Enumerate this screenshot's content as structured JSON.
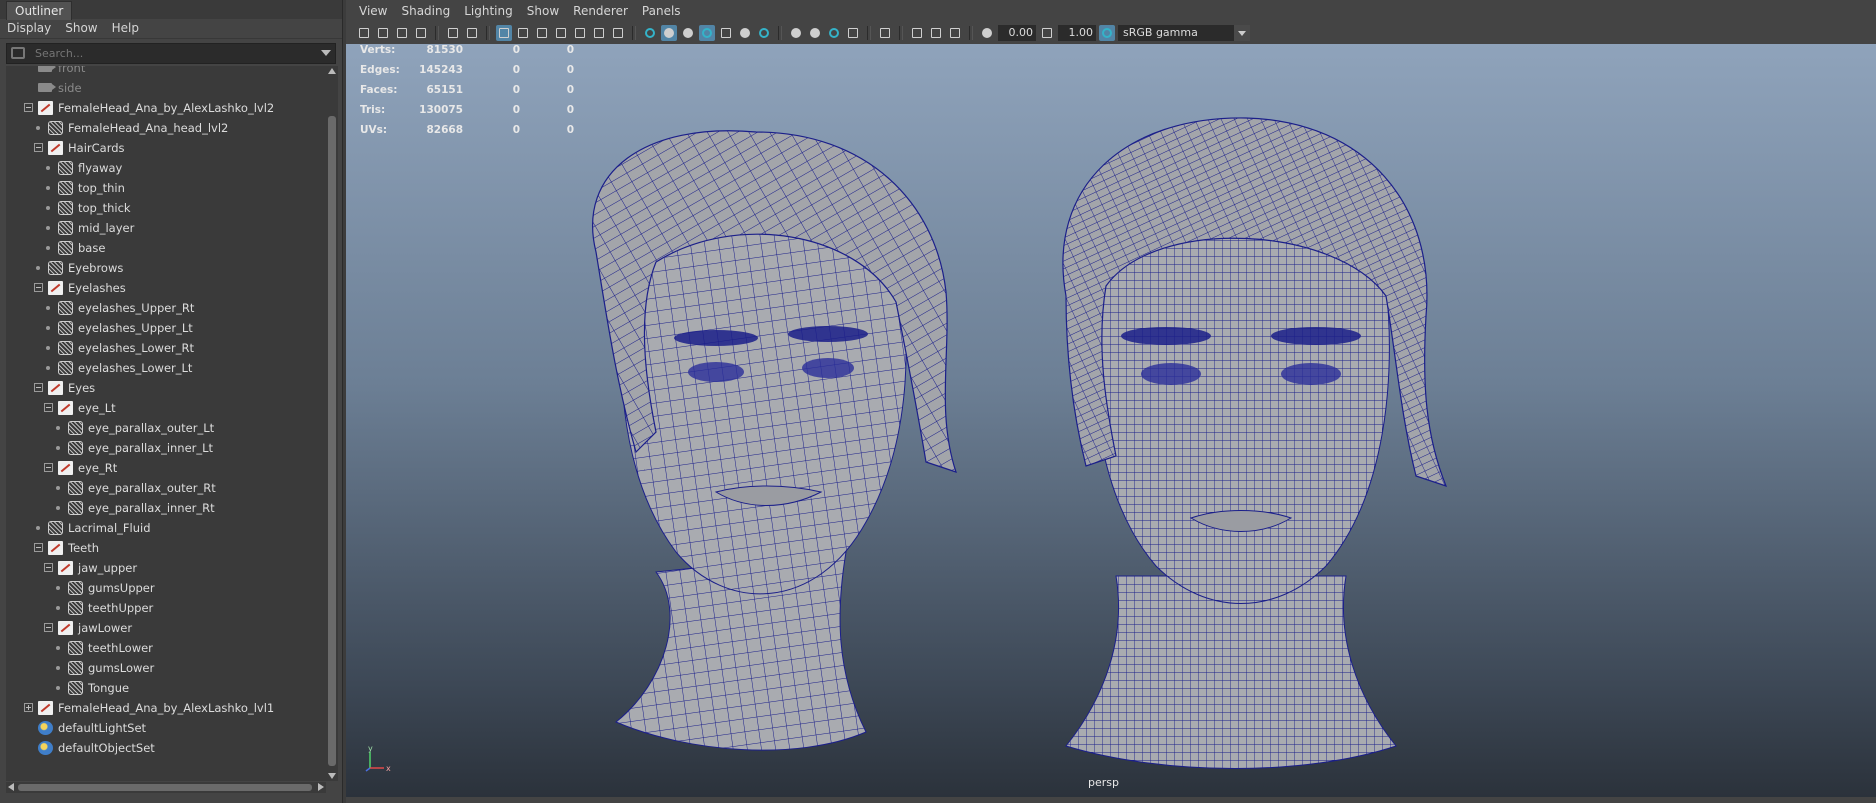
{
  "outliner": {
    "tab_label": "Outliner",
    "menu": [
      "Display",
      "Show",
      "Help"
    ],
    "search_placeholder": "Search...",
    "items": [
      {
        "label": "front",
        "depth": 0,
        "kind": "camera",
        "dim": true,
        "expander": "none"
      },
      {
        "label": "side",
        "depth": 0,
        "kind": "camera",
        "dim": true,
        "expander": "none"
      },
      {
        "label": "FemaleHead_Ana_by_AlexLashko_lvl2",
        "depth": 0,
        "kind": "group",
        "expander": "minus"
      },
      {
        "label": "FemaleHead_Ana_head_lvl2",
        "depth": 1,
        "kind": "mesh",
        "expander": "none"
      },
      {
        "label": "HairCards",
        "depth": 1,
        "kind": "group",
        "expander": "minus"
      },
      {
        "label": "flyaway",
        "depth": 2,
        "kind": "mesh",
        "expander": "none"
      },
      {
        "label": "top_thin",
        "depth": 2,
        "kind": "mesh",
        "expander": "none"
      },
      {
        "label": "top_thick",
        "depth": 2,
        "kind": "mesh",
        "expander": "none"
      },
      {
        "label": "mid_layer",
        "depth": 2,
        "kind": "mesh",
        "expander": "none"
      },
      {
        "label": "base",
        "depth": 2,
        "kind": "mesh",
        "expander": "none"
      },
      {
        "label": "Eyebrows",
        "depth": 1,
        "kind": "mesh",
        "expander": "none"
      },
      {
        "label": "Eyelashes",
        "depth": 1,
        "kind": "group",
        "expander": "minus"
      },
      {
        "label": "eyelashes_Upper_Rt",
        "depth": 2,
        "kind": "mesh",
        "expander": "none"
      },
      {
        "label": "eyelashes_Upper_Lt",
        "depth": 2,
        "kind": "mesh",
        "expander": "none"
      },
      {
        "label": "eyelashes_Lower_Rt",
        "depth": 2,
        "kind": "mesh",
        "expander": "none"
      },
      {
        "label": "eyelashes_Lower_Lt",
        "depth": 2,
        "kind": "mesh",
        "expander": "none"
      },
      {
        "label": "Eyes",
        "depth": 1,
        "kind": "group",
        "expander": "minus"
      },
      {
        "label": "eye_Lt",
        "depth": 2,
        "kind": "group",
        "expander": "minus"
      },
      {
        "label": "eye_parallax_outer_Lt",
        "depth": 3,
        "kind": "mesh",
        "expander": "none"
      },
      {
        "label": "eye_parallax_inner_Lt",
        "depth": 3,
        "kind": "mesh",
        "expander": "none"
      },
      {
        "label": "eye_Rt",
        "depth": 2,
        "kind": "group",
        "expander": "minus"
      },
      {
        "label": "eye_parallax_outer_Rt",
        "depth": 3,
        "kind": "mesh",
        "expander": "none"
      },
      {
        "label": "eye_parallax_inner_Rt",
        "depth": 3,
        "kind": "mesh",
        "expander": "none"
      },
      {
        "label": "Lacrimal_Fluid",
        "depth": 1,
        "kind": "mesh",
        "expander": "none"
      },
      {
        "label": "Teeth",
        "depth": 1,
        "kind": "group",
        "expander": "minus"
      },
      {
        "label": "jaw_upper",
        "depth": 2,
        "kind": "group",
        "expander": "minus"
      },
      {
        "label": "gumsUpper",
        "depth": 3,
        "kind": "mesh",
        "expander": "none"
      },
      {
        "label": "teethUpper",
        "depth": 3,
        "kind": "mesh",
        "expander": "none"
      },
      {
        "label": "jawLower",
        "depth": 2,
        "kind": "group",
        "expander": "minus"
      },
      {
        "label": "teethLower",
        "depth": 3,
        "kind": "mesh",
        "expander": "none"
      },
      {
        "label": "gumsLower",
        "depth": 3,
        "kind": "mesh",
        "expander": "none"
      },
      {
        "label": "Tongue",
        "depth": 3,
        "kind": "mesh",
        "expander": "none"
      },
      {
        "label": "FemaleHead_Ana_by_AlexLashko_lvl1",
        "depth": 0,
        "kind": "group",
        "expander": "plus"
      },
      {
        "label": "defaultLightSet",
        "depth": 0,
        "kind": "set",
        "expander": "none"
      },
      {
        "label": "defaultObjectSet",
        "depth": 0,
        "kind": "set",
        "expander": "none"
      }
    ]
  },
  "panel": {
    "menu": [
      "View",
      "Shading",
      "Lighting",
      "Show",
      "Renderer",
      "Panels"
    ],
    "exposure_value": "0.00",
    "gamma_value": "1.00",
    "color_space": "sRGB gamma",
    "camera_name": "persp"
  },
  "hud": [
    {
      "label": "Verts:",
      "v1": "81530",
      "v2": "0",
      "v3": "0"
    },
    {
      "label": "Edges:",
      "v1": "145243",
      "v2": "0",
      "v3": "0"
    },
    {
      "label": "Faces:",
      "v1": "65151",
      "v2": "0",
      "v3": "0"
    },
    {
      "label": "Tris:",
      "v1": "130075",
      "v2": "0",
      "v3": "0"
    },
    {
      "label": "UVs:",
      "v1": "82668",
      "v2": "0",
      "v3": "0"
    }
  ],
  "axis": {
    "y": "y",
    "x": "x"
  },
  "colors": {
    "wire": "#1b1f8a",
    "mesh": "#a9abb0",
    "accent": "#5285a6",
    "bg_top": "#8fa3bb",
    "bg_bottom": "#2b323b"
  },
  "icons": [
    "search-icon",
    "camera-icon",
    "group-icon",
    "mesh-icon",
    "set-icon"
  ]
}
